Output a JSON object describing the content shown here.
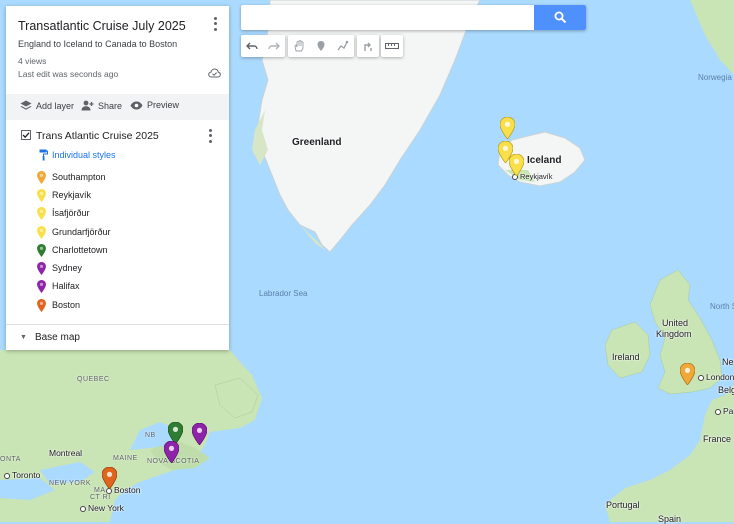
{
  "panel": {
    "title": "Transatlantic Cruise July 2025",
    "description": "England to Iceland to Canada to Boston",
    "views": "4 views",
    "last_edit": "Last edit was seconds ago",
    "actions": {
      "add_layer": "Add layer",
      "share": "Share",
      "preview": "Preview"
    },
    "layer": {
      "name": "Trans Atlantic Cruise 2025",
      "checked": true,
      "style_link": "Individual styles",
      "places": [
        {
          "name": "Southampton",
          "color": "#f0a83a",
          "icon": "map-pin"
        },
        {
          "name": "Reykjavík",
          "color": "#f9e04b",
          "icon": "map-pin"
        },
        {
          "name": "Ísafjörður",
          "color": "#f9e04b",
          "icon": "map-pin"
        },
        {
          "name": "Grundarfjörður",
          "color": "#f9e04b",
          "icon": "map-pin"
        },
        {
          "name": "Charlottetown",
          "color": "#2e7d32",
          "icon": "map-pin"
        },
        {
          "name": "Sydney",
          "color": "#8e24aa",
          "icon": "map-pin"
        },
        {
          "name": "Halifax",
          "color": "#8e24aa",
          "icon": "map-pin"
        },
        {
          "name": "Boston",
          "color": "#e0641e",
          "icon": "map-pin"
        }
      ]
    },
    "base_map": "Base map"
  },
  "search": {
    "value": "",
    "placeholder": ""
  },
  "map_labels": {
    "greenland": "Greenland",
    "iceland": "Iceland",
    "reykjavik": "Reykjavík",
    "labrador_sea": "Labrador Sea",
    "norwegian": "Norwegia",
    "north_sea": "North S",
    "united_kingdom_1": "United",
    "united_kingdom_2": "Kingdom",
    "ireland": "Ireland",
    "london": "London",
    "belgium": "Belg",
    "paris": "Paris",
    "netherlands": "Ne",
    "france": "France",
    "portugal": "Portugal",
    "spain": "Spain",
    "quebec": "QUEBEC",
    "nb": "NB",
    "maine": "MAINE",
    "nova_scotia": "NOVA SCOTIA",
    "montreal": "Montreal",
    "ontario": "ONTA",
    "toronto": "Toronto",
    "new_york_state": "NEW YORK",
    "ct_ri": "CT RI",
    "ma": "MA",
    "boston": "Boston",
    "new_york": "New York"
  },
  "colors": {
    "water": "#aadaff",
    "land": "#c9e4b5",
    "ice": "#f4f6f6",
    "link_blue": "#1a73e8",
    "search_button": "#4d90fe"
  }
}
